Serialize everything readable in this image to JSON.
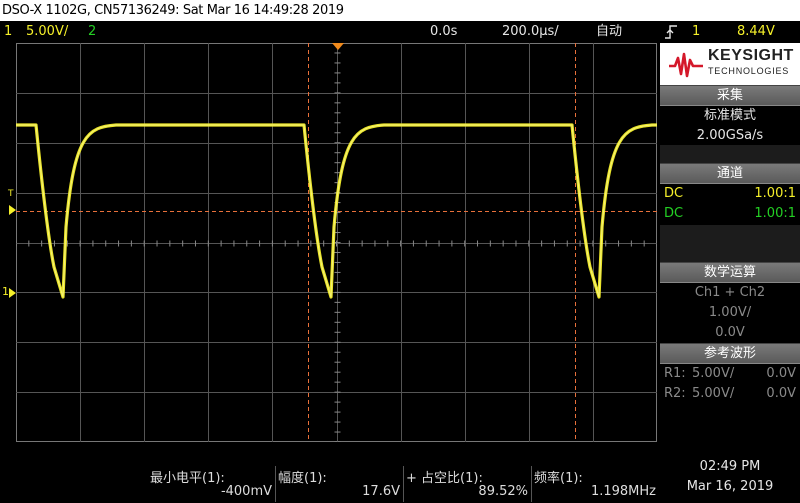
{
  "title": "DSO-X 1102G, CN57136249: Sat Mar 16 14:49:28 2019",
  "status": {
    "ch1_num": "1",
    "ch1_scale": "5.00V/",
    "ch2_num": "2",
    "time_offset": "0.0s",
    "time_scale": "200.0µs/",
    "trigger_mode": "自动",
    "trig_icon": "trigger-edge-icon",
    "trig_ch": "1",
    "trig_level": "8.44V"
  },
  "screen": {
    "trigger_marker": "T",
    "ch1_ground_marker": "1"
  },
  "logo": {
    "brand": "KEYSIGHT",
    "sub": "TECHNOLOGIES",
    "icon": "keysight-wave-icon"
  },
  "acquire": {
    "header": "采集",
    "mode": "标准模式",
    "rate": "2.00GSa/s"
  },
  "channels": {
    "header": "通道",
    "rows": [
      {
        "coupling": "DC",
        "probe": "1.00:1",
        "color": "#f5f02a"
      },
      {
        "coupling": "DC",
        "probe": "1.00:1",
        "color": "#24d024"
      }
    ]
  },
  "math": {
    "header": "数学运算",
    "func": "Ch1 + Ch2",
    "scale": "1.00V/",
    "offset": "0.0V"
  },
  "ref": {
    "header": "参考波形",
    "rows": [
      {
        "name": "R1:",
        "scale": "5.00V/",
        "offset": "0.0V"
      },
      {
        "name": "R2:",
        "scale": "5.00V/",
        "offset": "0.0V"
      }
    ]
  },
  "measurements": [
    {
      "label": "最小电平(1):",
      "value": "-400mV"
    },
    {
      "label": "幅度(1):",
      "value": "17.6V"
    },
    {
      "label": "+ 占空比(1):",
      "value": "89.52%"
    },
    {
      "label": "频率(1):",
      "value": "1.198MHz"
    }
  ],
  "clock": {
    "time": "02:49 PM",
    "date": "Mar 16, 2019"
  },
  "colors": {
    "ch1": "#f5f02a",
    "ch2": "#24d024",
    "grid": "#555555",
    "cursor": "#e8703a"
  }
}
